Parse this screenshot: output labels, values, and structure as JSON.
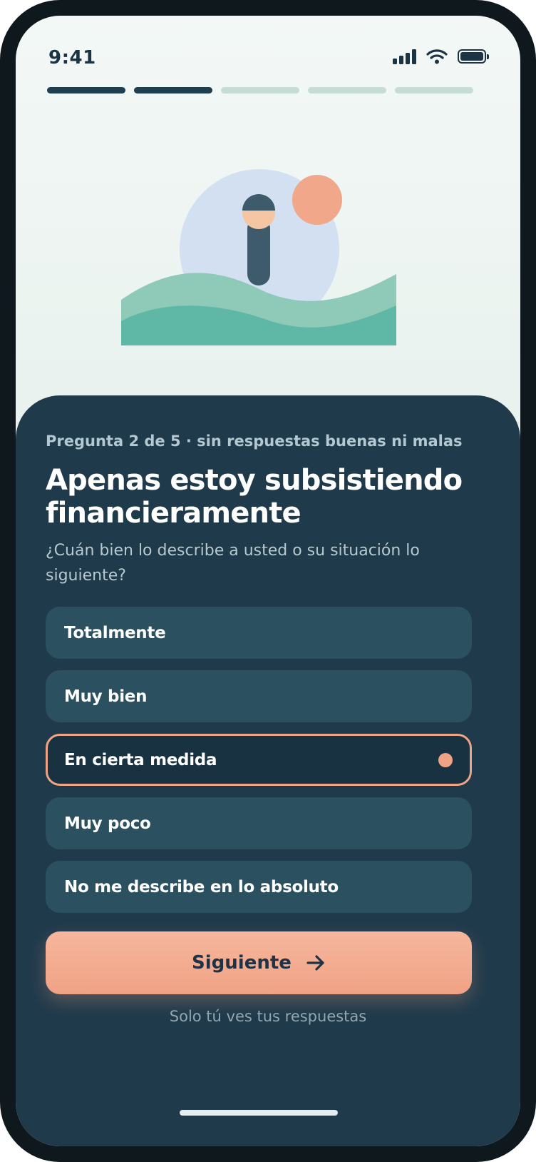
{
  "status_bar": {
    "time": "9:41"
  },
  "progress": {
    "current_step": 2,
    "total_steps": 5
  },
  "question": {
    "eyebrow": "Pregunta 2 de 5 · sin respuestas buenas ni malas",
    "title": "Apenas estoy subsistiendo financieramente",
    "subtitle": "¿Cuán bien lo describe a usted o su situación lo siguiente?"
  },
  "options": [
    {
      "label": "Totalmente",
      "selected": false
    },
    {
      "label": "Muy bien",
      "selected": false
    },
    {
      "label": "En cierta medida",
      "selected": true
    },
    {
      "label": "Muy poco",
      "selected": false
    },
    {
      "label": "No me describe en lo absoluto",
      "selected": false
    }
  ],
  "next_button": {
    "label": "Siguiente",
    "icon": "arrow-right-icon"
  },
  "footnote": "Solo tú ves tus respuestas",
  "colors": {
    "sheet_background": "#1f3a4b",
    "option_background": "#2b5060",
    "accent": "#f0a385",
    "progress_done": "#1f3e50",
    "progress_pending": "#c6ddd6"
  }
}
